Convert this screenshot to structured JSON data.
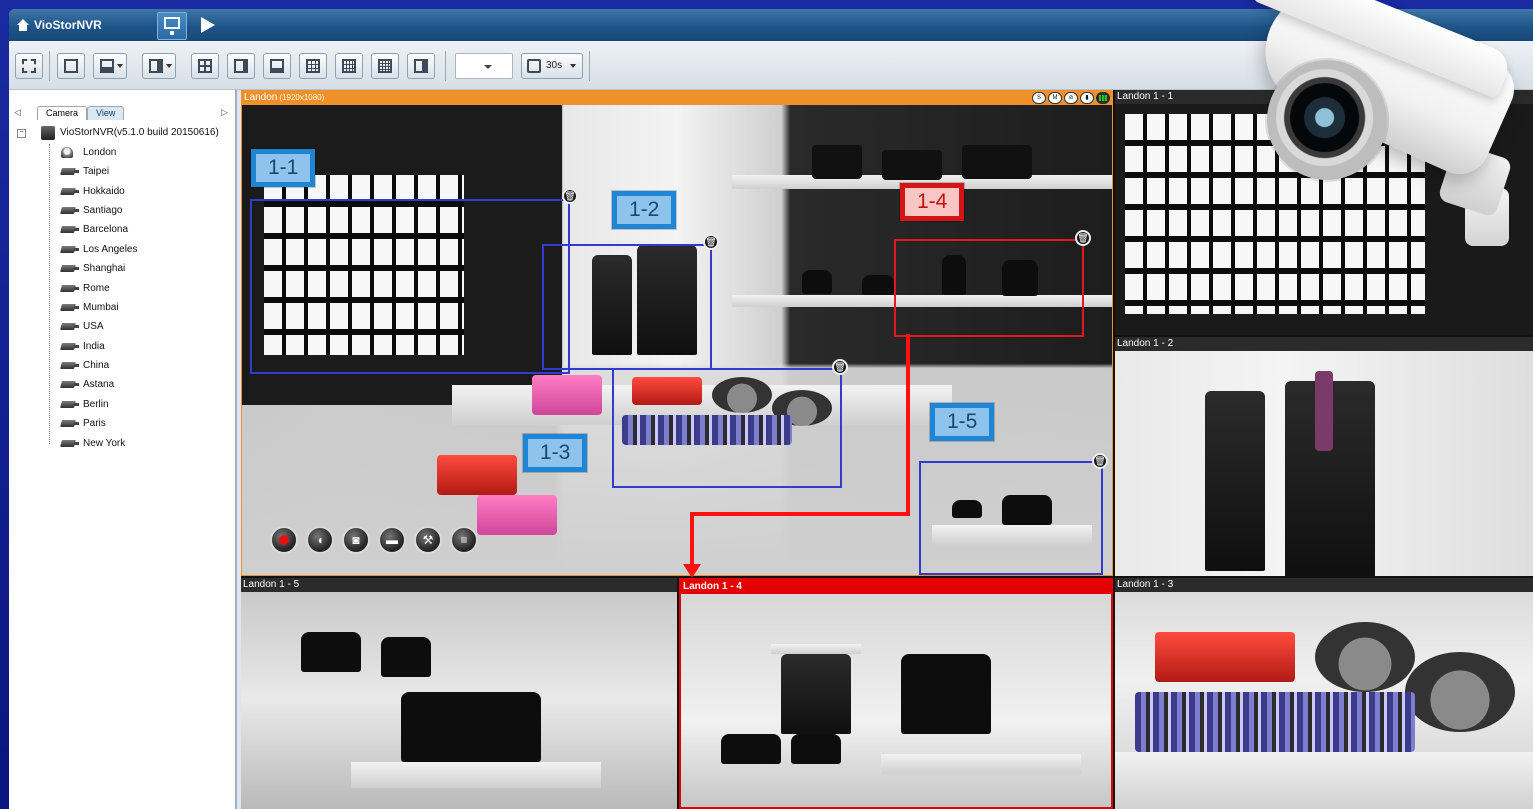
{
  "app": {
    "logo_text": "VioStorNVR"
  },
  "toolbar": {
    "sequence_interval": "30s"
  },
  "left_panel": {
    "tabs": [
      "Camera",
      "View"
    ],
    "root_label": "VioStorNVR(v5.1.0 build 20150616)",
    "cameras": [
      "London",
      "Taipei",
      "Hokkaido",
      "Santiago",
      "Barcelona",
      "Los Angeles",
      "Shanghai",
      "Rome",
      "Mumbai",
      "USA",
      "India",
      "China",
      "Astana",
      "Berlin",
      "Paris",
      "New York"
    ]
  },
  "main_view": {
    "title": "Landon",
    "resolution": "(1920x1080)",
    "zones": [
      {
        "label": "1-1"
      },
      {
        "label": "1-2"
      },
      {
        "label": "1-3"
      },
      {
        "label": "1-4",
        "highlight": true
      },
      {
        "label": "1-5"
      }
    ]
  },
  "tiles": [
    {
      "title": "Landon 1 - 1"
    },
    {
      "title": "Landon 1 - 2"
    },
    {
      "title": "Landon 1 - 5"
    },
    {
      "title": "Landon 1 - 4",
      "active": true
    },
    {
      "title": "Landon 1 - 3"
    }
  ],
  "colors": {
    "frame_blue": "#0b1580",
    "zone_blue": "#2f3ccf",
    "zone_red": "#e01a1a",
    "label_blue_border": "#1f86d6",
    "label_red_border": "#d41515",
    "main_header_orange": "#f0902a",
    "active_header_red": "#e40000"
  },
  "icons": {
    "zone_delete": "trash-icon",
    "controls": [
      "record-icon",
      "audio-icon",
      "snapshot-icon",
      "digital-zoom-icon",
      "settings-wrench-icon",
      "notes-icon"
    ]
  }
}
